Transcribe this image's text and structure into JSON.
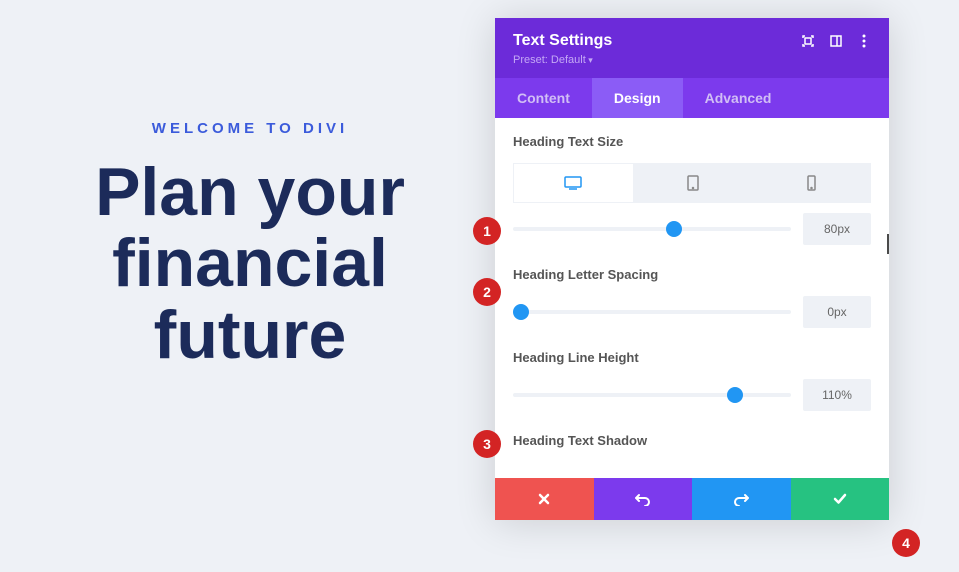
{
  "content": {
    "eyebrow": "WELCOME TO DIVI",
    "headline": "Plan your financial future"
  },
  "panel": {
    "title": "Text Settings",
    "preset": "Preset: Default",
    "tabs": {
      "content": "Content",
      "design": "Design",
      "advanced": "Advanced"
    },
    "textSize": {
      "label": "Heading Text Size",
      "value": "80px",
      "thumb_pct": 58
    },
    "letterSpacing": {
      "label": "Heading Letter Spacing",
      "value": "0px",
      "thumb_pct": 3
    },
    "lineHeight": {
      "label": "Heading Line Height",
      "value": "110%",
      "thumb_pct": 80
    },
    "textShadow": {
      "label": "Heading Text Shadow"
    }
  },
  "badges": {
    "b1": "1",
    "b2": "2",
    "b3": "3",
    "b4": "4"
  }
}
